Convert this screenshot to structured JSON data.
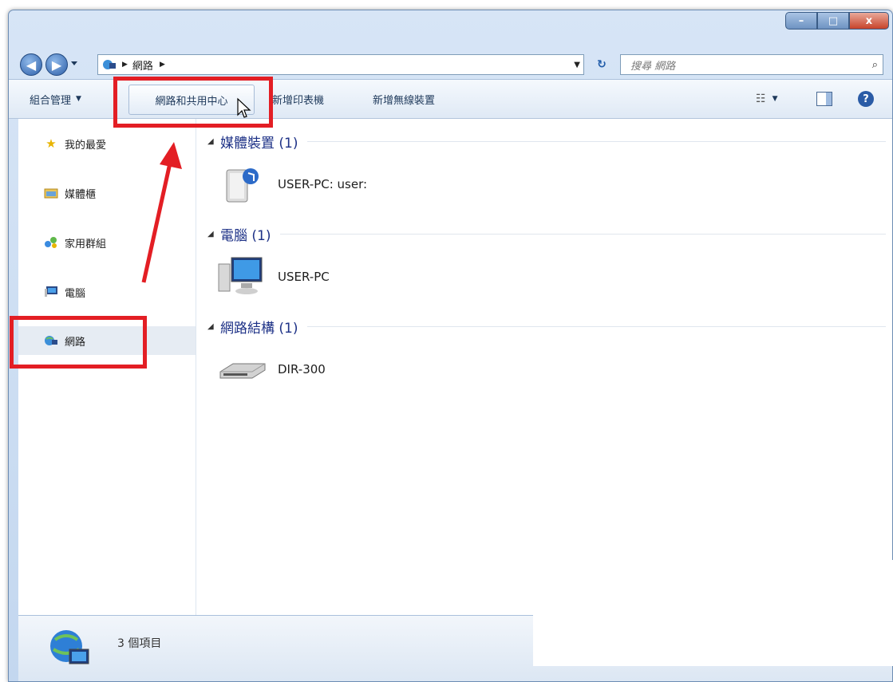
{
  "window": {
    "min_label": "–",
    "max_label": "□",
    "close_label": "x"
  },
  "nav": {
    "back_label": "◀",
    "forward_label": "▶",
    "breadcrumb": "網路",
    "search_placeholder": "搜尋 網路"
  },
  "toolbar": {
    "organize": "組合管理",
    "network_center": "網路和共用中心",
    "add_printer": "新增印表機",
    "add_wireless": "新增無線裝置"
  },
  "sidebar": {
    "items": [
      {
        "label": "我的最愛",
        "icon": "star-icon"
      },
      {
        "label": "媒體櫃",
        "icon": "library-icon"
      },
      {
        "label": "家用群組",
        "icon": "homegroup-icon"
      },
      {
        "label": "電腦",
        "icon": "computer-icon"
      },
      {
        "label": "網路",
        "icon": "network-icon"
      }
    ]
  },
  "groups": [
    {
      "title": "媒體裝置 (1)",
      "item": "USER-PC: user:",
      "icon": "media-device-icon"
    },
    {
      "title": "電腦 (1)",
      "item": "USER-PC",
      "icon": "computer-icon"
    },
    {
      "title": "網路結構 (1)",
      "item": "DIR-300",
      "icon": "router-icon"
    }
  ],
  "status": {
    "count": "3 個項目"
  },
  "colors": {
    "highlight_red": "#e31e24",
    "group_header": "#1e3287"
  }
}
